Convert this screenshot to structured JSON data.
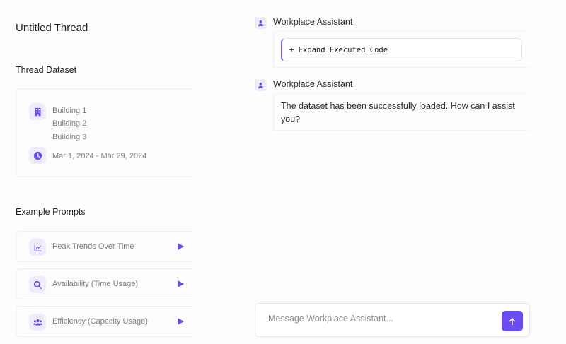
{
  "sidebar": {
    "title": "Untitled Thread",
    "dataset_heading": "Thread Dataset",
    "buildings": [
      "Building 1",
      "Building 2",
      "Building 3"
    ],
    "date_range": "Mar 1, 2024 - Mar 29, 2024",
    "prompts_heading": "Example Prompts",
    "prompts": [
      {
        "label": "Peak Trends Over Time",
        "icon": "chart-line-icon"
      },
      {
        "label": "Availability (Time Usage)",
        "icon": "search-icon"
      },
      {
        "label": "Efficiency (Capacity Usage)",
        "icon": "users-icon"
      }
    ]
  },
  "chat": {
    "messages": [
      {
        "sender": "Workplace Assistant",
        "code_label": "+ Expand Executed Code"
      },
      {
        "sender": "Workplace Assistant",
        "text": "The dataset has been successfully loaded. How can I assist you?"
      }
    ],
    "input_placeholder": "Message Workplace Assistant..."
  },
  "colors": {
    "accent": "#6a4cf0"
  }
}
